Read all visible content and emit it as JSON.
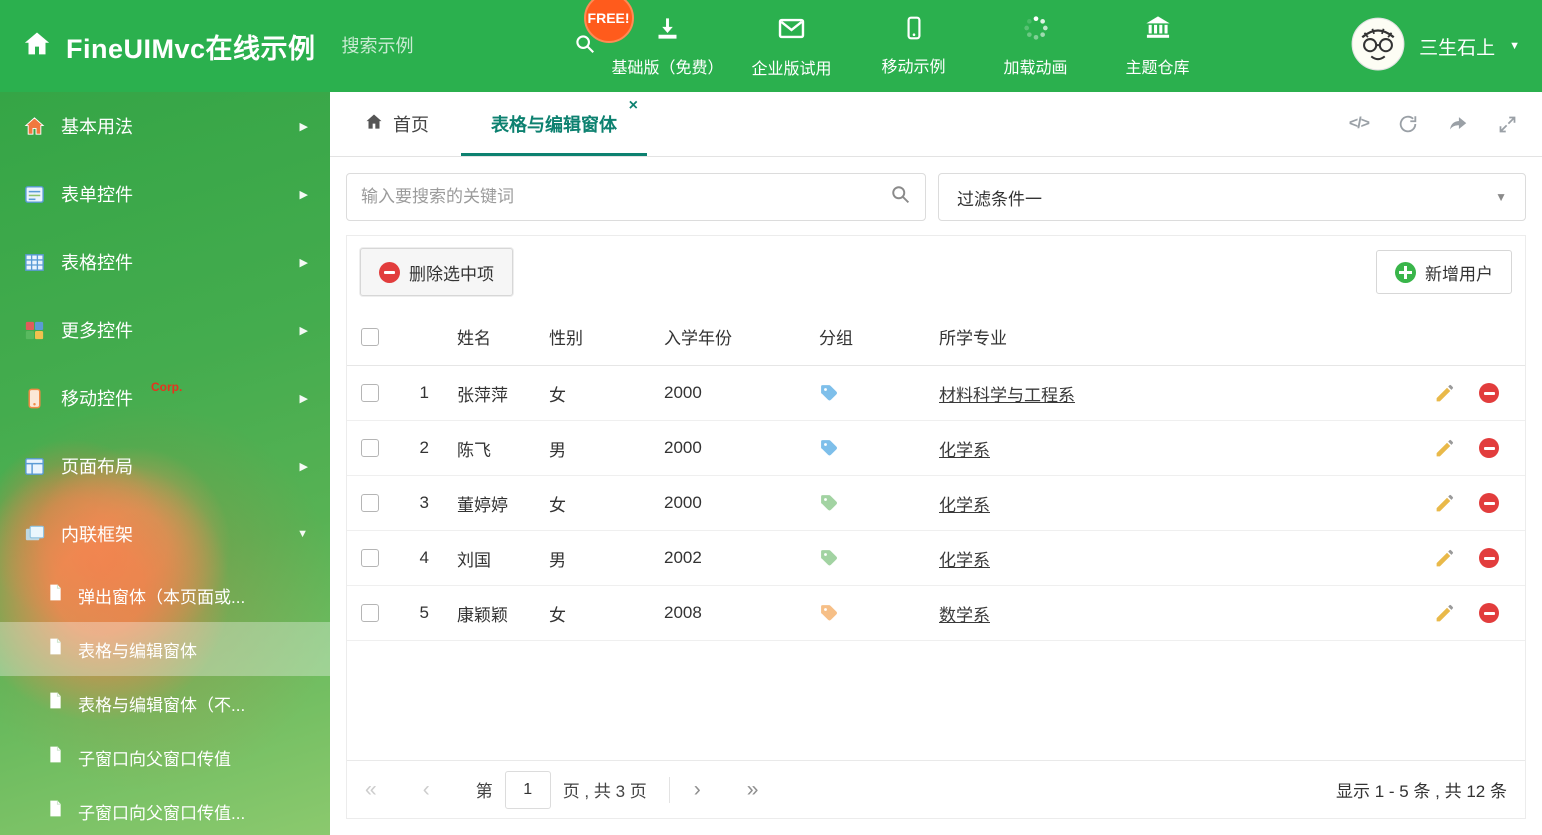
{
  "icons": {
    "close": "×",
    "code": "</>",
    "caret_right": "▶",
    "caret_down": "▼",
    "dropdown_caret": "▼",
    "user_caret": "▼",
    "first": "«",
    "prev": "‹",
    "next": "›",
    "last": "»"
  },
  "header": {
    "title": "FineUIMvc在线示例",
    "search_placeholder": "搜索示例",
    "free_badge": "FREE!",
    "nav": [
      {
        "label": "基础版（免费）"
      },
      {
        "label": "企业版试用"
      },
      {
        "label": "移动示例"
      },
      {
        "label": "加载动画"
      },
      {
        "label": "主题仓库"
      }
    ],
    "user": "三生石上"
  },
  "sidebar": {
    "items": [
      {
        "label": "基本用法"
      },
      {
        "label": "表单控件"
      },
      {
        "label": "表格控件"
      },
      {
        "label": "更多控件"
      },
      {
        "label": "移动控件",
        "badge": "Corp."
      },
      {
        "label": "页面布局"
      },
      {
        "label": "内联框架"
      }
    ],
    "subitems": [
      {
        "label": "弹出窗体（本页面或..."
      },
      {
        "label": "表格与编辑窗体"
      },
      {
        "label": "表格与编辑窗体（不..."
      },
      {
        "label": "子窗口向父窗口传值"
      },
      {
        "label": "子窗口向父窗口传值..."
      }
    ]
  },
  "tabs": {
    "home": "首页",
    "active": "表格与编辑窗体"
  },
  "filter": {
    "search_placeholder": "输入要搜索的关键词",
    "dropdown_value": "过滤条件一"
  },
  "actions": {
    "delete_selected": "删除选中项",
    "add_user": "新增用户"
  },
  "table": {
    "headers": {
      "name": "姓名",
      "gender": "性别",
      "year": "入学年份",
      "group": "分组",
      "major": "所学专业"
    },
    "rows": [
      {
        "num": "1",
        "name": "张萍萍",
        "gender": "女",
        "year": "2000",
        "tag_color": "#5fb0e5",
        "major": "材料科学与工程系"
      },
      {
        "num": "2",
        "name": "陈飞",
        "gender": "男",
        "year": "2000",
        "tag_color": "#5fb0e5",
        "major": "化学系"
      },
      {
        "num": "3",
        "name": "董婷婷",
        "gender": "女",
        "year": "2000",
        "tag_color": "#8cc98c",
        "major": "化学系"
      },
      {
        "num": "4",
        "name": "刘国",
        "gender": "男",
        "year": "2002",
        "tag_color": "#8cc98c",
        "major": "化学系"
      },
      {
        "num": "5",
        "name": "康颖颖",
        "gender": "女",
        "year": "2008",
        "tag_color": "#f5b06a",
        "major": "数学系"
      }
    ]
  },
  "pagination": {
    "prefix": "第",
    "page_value": "1",
    "suffix": "页 , 共 3 页",
    "summary": "显示 1 - 5 条 , 共 12 条"
  },
  "colors": {
    "header_green": "#2bb04e",
    "active_tab_teal": "#0d8170",
    "free_badge_orange": "#ff5b1c",
    "delete_red": "#e23d3d",
    "add_green": "#39b54a",
    "edit_pencil_yellow": "#e9b949",
    "corp_red": "#e8321e"
  }
}
